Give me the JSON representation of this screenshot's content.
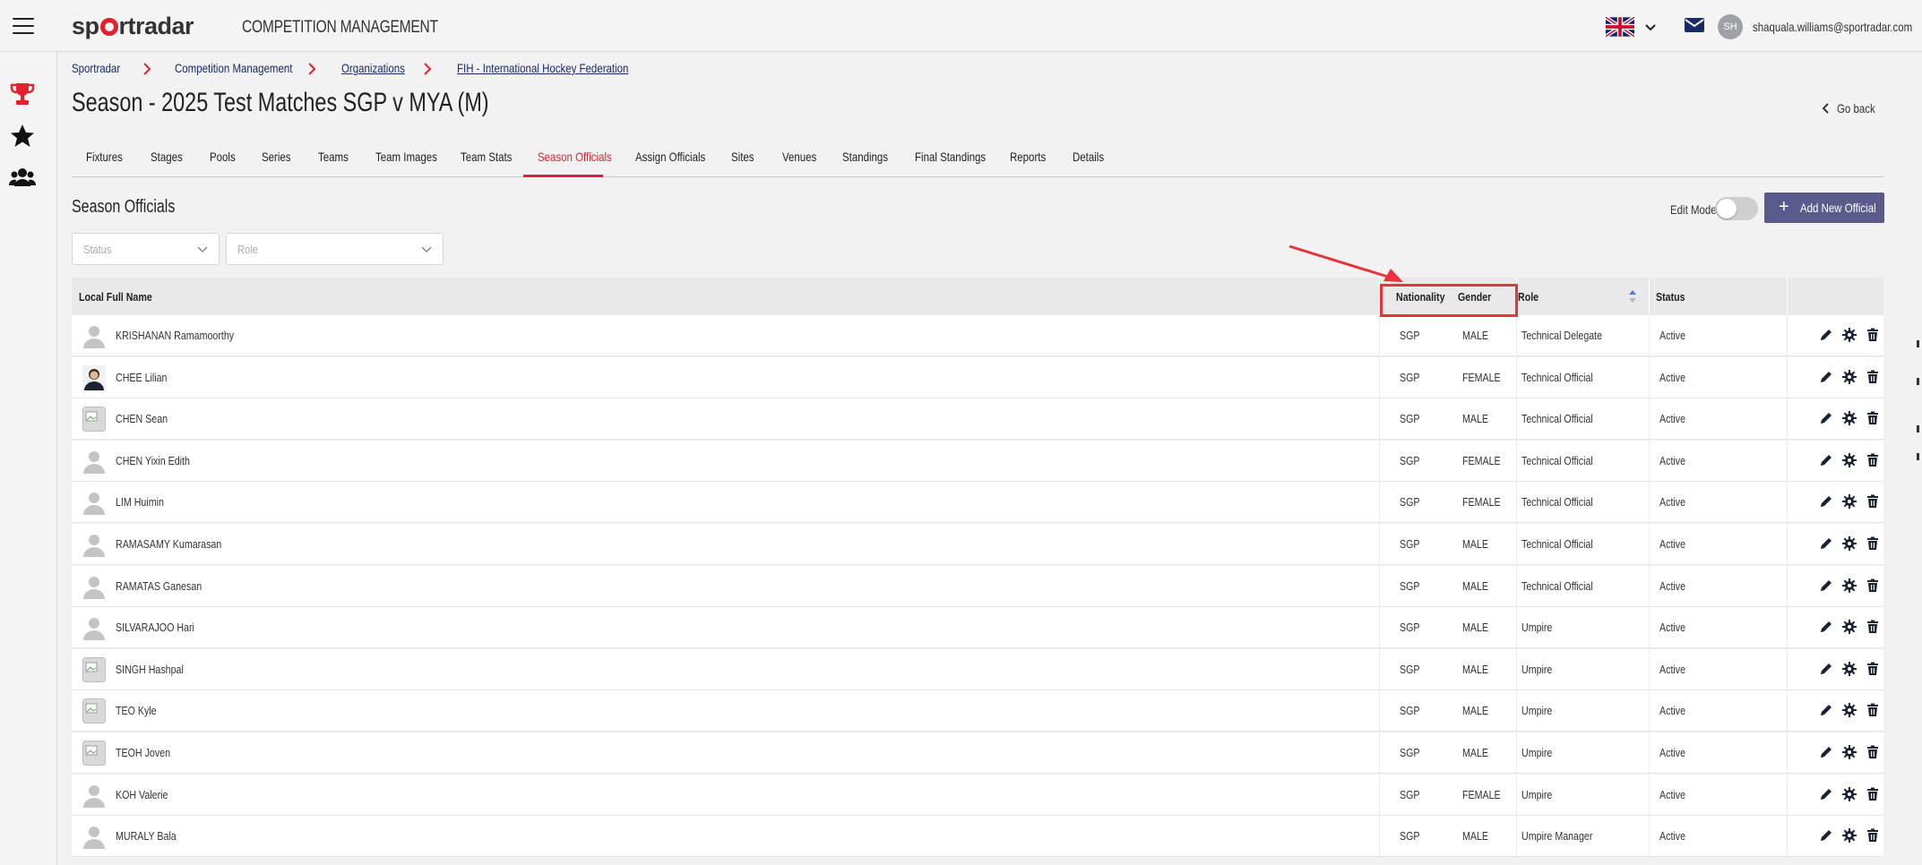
{
  "header": {
    "logo_text": "sportradar",
    "app_title": "COMPETITION MANAGEMENT",
    "user_initials": "SH",
    "user_email": "shaquala.williams@sportradar.com",
    "language": "EN (United Kingdom flag)"
  },
  "sidebar": {
    "items": [
      {
        "name": "Competitions",
        "icon": "trophy-icon",
        "color": "#e5202e"
      },
      {
        "name": "Favourites",
        "icon": "star-icon",
        "color": "#111111"
      },
      {
        "name": "People",
        "icon": "users-icon",
        "color": "#111111"
      }
    ]
  },
  "breadcrumb": [
    {
      "label": "Sportradar"
    },
    {
      "label": "Competition Management"
    },
    {
      "label": "Organizations"
    },
    {
      "label": "FIH - International Hockey Federation"
    }
  ],
  "page": {
    "title": "Season - 2025 Test Matches SGP v MYA (M)",
    "go_back": "Go back"
  },
  "tabs": [
    "Fixtures",
    "Stages",
    "Pools",
    "Series",
    "Teams",
    "Team Images",
    "Team Stats",
    "Season Officials",
    "Assign Officials",
    "Sites",
    "Venues",
    "Standings",
    "Final Standings",
    "Reports",
    "Details"
  ],
  "active_tab": "Season Officials",
  "section": {
    "title": "Season Officials",
    "edit_mode_label": "Edit Mode",
    "add_button": "Add New Official",
    "filters": {
      "status_placeholder": "Status",
      "role_placeholder": "Role"
    }
  },
  "table": {
    "columns": [
      "Local Full Name",
      "Nationality",
      "Gender",
      "Role",
      "Status"
    ],
    "rows": [
      {
        "name": "KRISHANAN Ramamoorthy",
        "nationality": "SGP",
        "gender": "MALE",
        "role": "Technical Delegate",
        "status": "Active",
        "avatar": "placeholder"
      },
      {
        "name": "CHEE Lilian",
        "nationality": "SGP",
        "gender": "FEMALE",
        "role": "Technical Official",
        "status": "Active",
        "avatar": "photo"
      },
      {
        "name": "CHEN Sean",
        "nationality": "SGP",
        "gender": "MALE",
        "role": "Technical Official",
        "status": "Active",
        "avatar": "broken"
      },
      {
        "name": "CHEN Yixin Edith",
        "nationality": "SGP",
        "gender": "FEMALE",
        "role": "Technical Official",
        "status": "Active",
        "avatar": "placeholder"
      },
      {
        "name": "LIM Huimin",
        "nationality": "SGP",
        "gender": "FEMALE",
        "role": "Technical Official",
        "status": "Active",
        "avatar": "placeholder"
      },
      {
        "name": "RAMASAMY Kumarasan",
        "nationality": "SGP",
        "gender": "MALE",
        "role": "Technical Official",
        "status": "Active",
        "avatar": "placeholder"
      },
      {
        "name": "RAMATAS Ganesan",
        "nationality": "SGP",
        "gender": "MALE",
        "role": "Technical Official",
        "status": "Active",
        "avatar": "placeholder"
      },
      {
        "name": "SILVARAJOO Hari",
        "nationality": "SGP",
        "gender": "MALE",
        "role": "Umpire",
        "status": "Active",
        "avatar": "placeholder"
      },
      {
        "name": "SINGH Hashpal",
        "nationality": "SGP",
        "gender": "MALE",
        "role": "Umpire",
        "status": "Active",
        "avatar": "broken"
      },
      {
        "name": "TEO Kyle",
        "nationality": "SGP",
        "gender": "MALE",
        "role": "Umpire",
        "status": "Active",
        "avatar": "broken"
      },
      {
        "name": "TEOH Joven",
        "nationality": "SGP",
        "gender": "MALE",
        "role": "Umpire",
        "status": "Active",
        "avatar": "broken"
      },
      {
        "name": "KOH Valerie",
        "nationality": "SGP",
        "gender": "FEMALE",
        "role": "Umpire",
        "status": "Active",
        "avatar": "placeholder"
      },
      {
        "name": "MURALY Bala",
        "nationality": "SGP",
        "gender": "MALE",
        "role": "Umpire Manager",
        "status": "Active",
        "avatar": "placeholder"
      }
    ],
    "row_actions": [
      "pencil-icon",
      "gear-icon",
      "trash-icon"
    ]
  },
  "colors": {
    "accent_red": "#e5202e",
    "navy": "#1a2a66",
    "button": "#5a5a8c",
    "annotation": "#e8323c"
  }
}
